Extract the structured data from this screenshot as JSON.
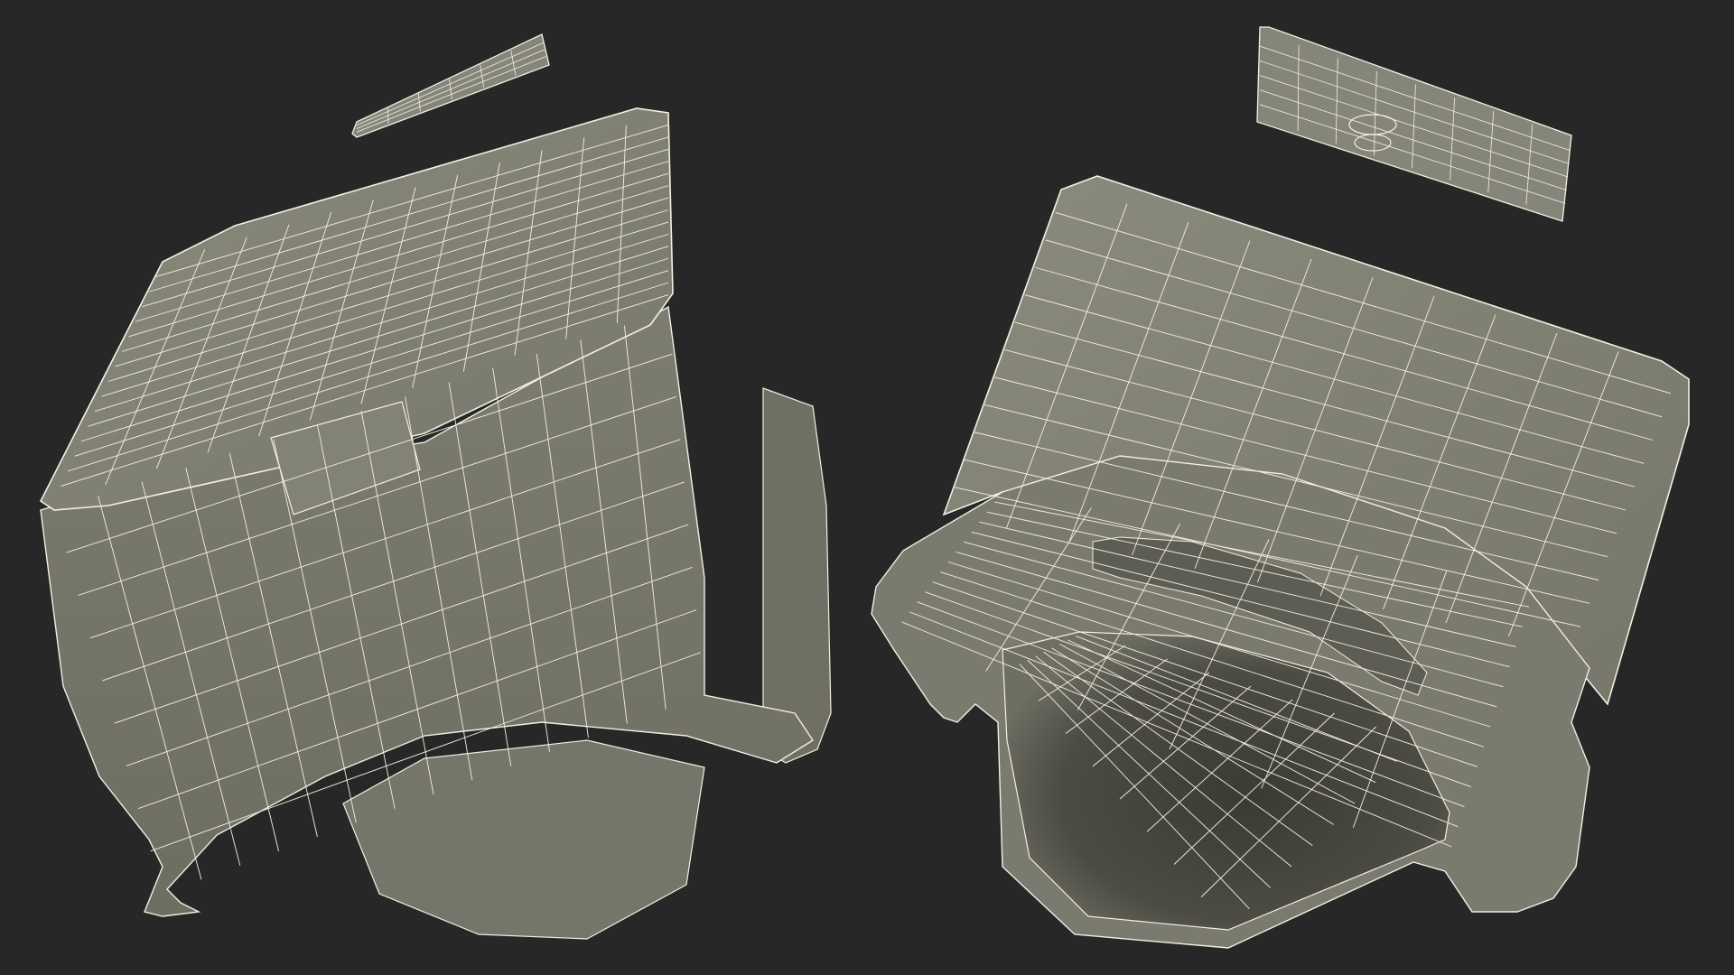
{
  "scene": {
    "background": "#272727",
    "surface_color": "#7f7f72",
    "surface_dark": "#3a3a34",
    "wire_color": "#f2f0e2",
    "objects": [
      {
        "name": "left-enclosure-view",
        "kind": "wireframe-box"
      },
      {
        "name": "left-lid-part",
        "kind": "wireframe-plate"
      },
      {
        "name": "right-enclosure-view",
        "kind": "wireframe-box"
      },
      {
        "name": "right-lid-part",
        "kind": "wireframe-plate"
      }
    ]
  }
}
